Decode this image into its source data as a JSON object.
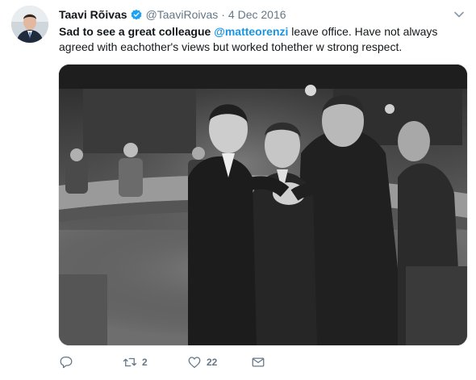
{
  "tweet": {
    "author": {
      "display_name": "Taavi Rõivas",
      "handle": "@TaaviRoivas",
      "verified": true
    },
    "separator": "·",
    "date": "4 Dec 2016",
    "text": {
      "part1": "Sad to see a great colleague ",
      "mention": "@matteorenzi",
      "part2": " leave office. Have not always agreed with eachother's views but worked tohether w strong respect."
    },
    "actions": {
      "reply": {
        "icon": "reply-icon",
        "count": ""
      },
      "retweet": {
        "icon": "retweet-icon",
        "count": "2"
      },
      "like": {
        "icon": "heart-icon",
        "count": "22"
      },
      "message": {
        "icon": "direct-message-icon",
        "count": ""
      }
    }
  },
  "colors": {
    "text": "#14171a",
    "secondary": "#657786",
    "link": "#1b95e0",
    "verified_badge": "#1da1f2"
  }
}
